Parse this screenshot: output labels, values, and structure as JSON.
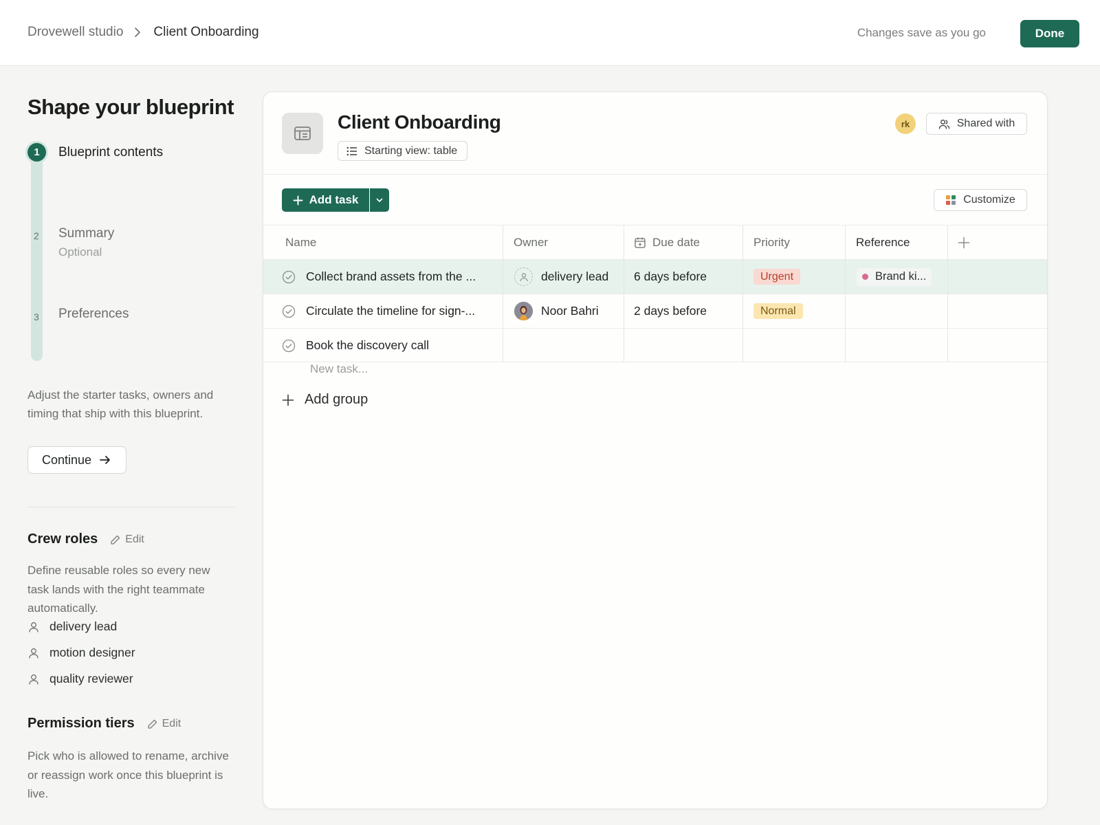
{
  "breadcrumb": {
    "workspace": "Drovewell studio",
    "current": "Client Onboarding"
  },
  "header": {
    "save_note": "Changes save as you go",
    "done_label": "Done"
  },
  "sidebar": {
    "title": "Shape your blueprint",
    "steps": [
      {
        "number": "1",
        "label": "Blueprint contents",
        "sub": ""
      },
      {
        "number": "2",
        "label": "Summary",
        "sub": "Optional"
      },
      {
        "number": "3",
        "label": "Preferences",
        "sub": ""
      }
    ],
    "description": "Adjust the starter tasks, owners and timing that ship with this blueprint.",
    "continue_label": "Continue",
    "crew_roles": {
      "title": "Crew roles",
      "edit_label": "Edit",
      "description": "Define reusable roles so every new task lands with the right teammate automatically.",
      "roles": [
        "delivery lead",
        "motion designer",
        "quality reviewer"
      ]
    },
    "permission_tiers": {
      "title": "Permission tiers",
      "edit_label": "Edit",
      "description": "Pick who is allowed to rename, archive or reassign work once this blueprint is live."
    }
  },
  "blueprint": {
    "title": "Client Onboarding",
    "starting_view": "Starting view: table",
    "avatar_initials": "rk",
    "shared_label": "Shared with",
    "add_task_label": "Add task",
    "customize_label": "Customize",
    "columns": [
      "Name",
      "Owner",
      "Due date",
      "Priority",
      "Reference"
    ],
    "rows": [
      {
        "name": "Collect brand assets from the ...",
        "owner": "delivery lead",
        "owner_type": "role",
        "due": "6 days before",
        "priority": "Urgent",
        "reference": "Brand ki..."
      },
      {
        "name": "Circulate the timeline for sign-...",
        "owner": "Noor Bahri",
        "owner_type": "person",
        "due": "2 days before",
        "priority": "Normal",
        "reference": ""
      },
      {
        "name": "Book the discovery call",
        "owner": "",
        "owner_type": "",
        "due": "",
        "priority": "",
        "reference": ""
      }
    ],
    "new_task_placeholder": "New task...",
    "add_group_label": "Add group"
  },
  "colors": {
    "accent": "#1e6a55",
    "urgent_bg": "#f9d9d2",
    "normal_bg": "#fbe6b0",
    "row_highlight": "#e7f2ec"
  }
}
